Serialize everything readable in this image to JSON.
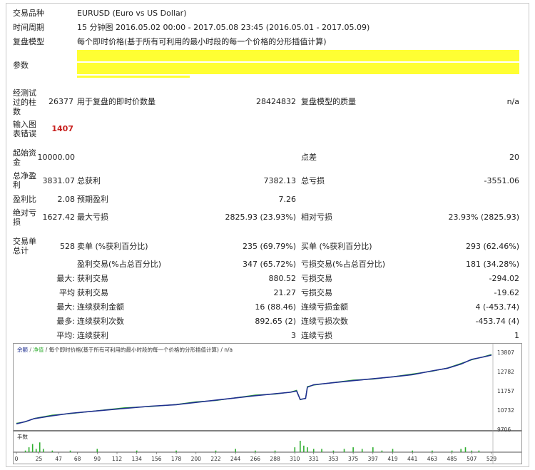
{
  "header": {
    "symbol_label": "交易品种",
    "symbol_value": "EURUSD (Euro vs US Dollar)",
    "period_label": "时间周期",
    "period_value": "15 分钟图 2016.05.02 00:00 - 2017.05.08 23:45 (2016.05.01 - 2017.05.09)",
    "model_label": "复盘模型",
    "model_value": "每个即时价格(基于所有可利用的最小时段的每一个价格的分形插值计算)",
    "params_label": "参数"
  },
  "tested": {
    "bars_label": "经测试过的柱数",
    "bars_value": "26377",
    "ticks_label": "用于复盘的即时价数量",
    "ticks_value": "28424832",
    "quality_label": "复盘模型的质量",
    "quality_value": "n/a",
    "errors_label": "输入图表错误",
    "errors_value": "1407"
  },
  "results": {
    "deposit_label": "起始资金",
    "deposit_value": "10000.00",
    "spread_label": "点差",
    "spread_value": "20",
    "netprofit_label": "总净盈利",
    "netprofit_value": "3831.07",
    "grossprofit_label": "总获利",
    "grossprofit_value": "7382.13",
    "grossloss_label": "总亏损",
    "grossloss_value": "-3551.06",
    "pf_label": "盈利比",
    "pf_value": "2.08",
    "payoff_label": "预期盈利",
    "payoff_value": "7.26",
    "absdd_label": "绝对亏损",
    "absdd_value": "1627.42",
    "maxdd_label": "最大亏损",
    "maxdd_value": "2825.93 (23.93%)",
    "reldd_label": "相对亏损",
    "reldd_value": "23.93% (2825.93)"
  },
  "trades": {
    "total_label": "交易单总计",
    "total_value": "528",
    "short_label": "卖单 (%获利百分比)",
    "short_value": "235 (69.79%)",
    "long_label": "买单 (%获利百分比)",
    "long_value": "293 (62.46%)",
    "profit_label": "盈利交易(%占总百分比)",
    "profit_value": "347 (65.72%)",
    "loss_label": "亏损交易(%占总百分比)",
    "loss_value": "181 (34.28%)",
    "rows": [
      {
        "prefix": "最大:",
        "l_label": "获利交易",
        "l_value": "880.52",
        "r_label": "亏损交易",
        "r_value": "-294.02"
      },
      {
        "prefix": "平均",
        "l_label": "获利交易",
        "l_value": "21.27",
        "r_label": "亏损交易",
        "r_value": "-19.62"
      },
      {
        "prefix": "最大:",
        "l_label": "连续获利金额",
        "l_value": "16 (88.46)",
        "r_label": "连续亏损金额",
        "r_value": "4 (-453.74)"
      },
      {
        "prefix": "最多:",
        "l_label": "连续获利次数",
        "l_value": "892.65 (2)",
        "r_label": "连续亏损次数",
        "r_value": "-453.74 (4)"
      },
      {
        "prefix": "平均:",
        "l_label": "连续获利",
        "l_value": "3",
        "r_label": "连续亏损",
        "r_value": "1"
      }
    ]
  },
  "chart_data": {
    "type": "line",
    "legend": "余额 / 净值 / 每个即时价格(基于所有可利用的最小时段的每一个价格的分形插值计算) / n/a",
    "legend_balance": "余额",
    "legend_equity": "净值",
    "legend_rest": "/ 每个即时价格(基于所有可利用的最小时段的每一个价格的分形插值计算) / n/a",
    "volume_label": "手数",
    "y_ticks": [
      "13807",
      "12782",
      "11757",
      "10732",
      "9706"
    ],
    "ylim": [
      9706,
      13807
    ],
    "x_ticks": [
      "0",
      "25",
      "47",
      "68",
      "90",
      "112",
      "134",
      "156",
      "178",
      "200",
      "222",
      "244",
      "266",
      "288",
      "310",
      "331",
      "353",
      "375",
      "397",
      "419",
      "441",
      "463",
      "485",
      "507",
      "529"
    ],
    "xlim": [
      0,
      529
    ],
    "balance_color": "#1f2f8f",
    "equity_color": "#2fae2f",
    "balance": [
      [
        0,
        10000
      ],
      [
        10,
        10120
      ],
      [
        20,
        10280
      ],
      [
        40,
        10430
      ],
      [
        60,
        10560
      ],
      [
        90,
        10690
      ],
      [
        120,
        10820
      ],
      [
        150,
        10940
      ],
      [
        178,
        11020
      ],
      [
        200,
        11140
      ],
      [
        222,
        11260
      ],
      [
        244,
        11380
      ],
      [
        266,
        11500
      ],
      [
        288,
        11600
      ],
      [
        305,
        11680
      ],
      [
        312,
        11750
      ],
      [
        316,
        11300
      ],
      [
        322,
        11350
      ],
      [
        324,
        11950
      ],
      [
        331,
        12080
      ],
      [
        353,
        12190
      ],
      [
        375,
        12300
      ],
      [
        397,
        12400
      ],
      [
        419,
        12500
      ],
      [
        441,
        12620
      ],
      [
        463,
        12820
      ],
      [
        480,
        12960
      ],
      [
        495,
        13180
      ],
      [
        507,
        13430
      ],
      [
        520,
        13560
      ],
      [
        529,
        13660
      ]
    ],
    "volume": [
      [
        10,
        1
      ],
      [
        14,
        3
      ],
      [
        18,
        5
      ],
      [
        22,
        2
      ],
      [
        26,
        6
      ],
      [
        30,
        2
      ],
      [
        40,
        1
      ],
      [
        60,
        1
      ],
      [
        90,
        2
      ],
      [
        134,
        1
      ],
      [
        178,
        1
      ],
      [
        222,
        1
      ],
      [
        244,
        2
      ],
      [
        266,
        1
      ],
      [
        288,
        1
      ],
      [
        310,
        3
      ],
      [
        316,
        7
      ],
      [
        320,
        4
      ],
      [
        324,
        3
      ],
      [
        331,
        2
      ],
      [
        340,
        2
      ],
      [
        353,
        1
      ],
      [
        365,
        2
      ],
      [
        375,
        3
      ],
      [
        385,
        2
      ],
      [
        397,
        3
      ],
      [
        407,
        1
      ],
      [
        419,
        2
      ],
      [
        441,
        1
      ],
      [
        463,
        1
      ],
      [
        485,
        1
      ],
      [
        495,
        2
      ],
      [
        500,
        3
      ],
      [
        507,
        1
      ],
      [
        515,
        1
      ]
    ]
  }
}
